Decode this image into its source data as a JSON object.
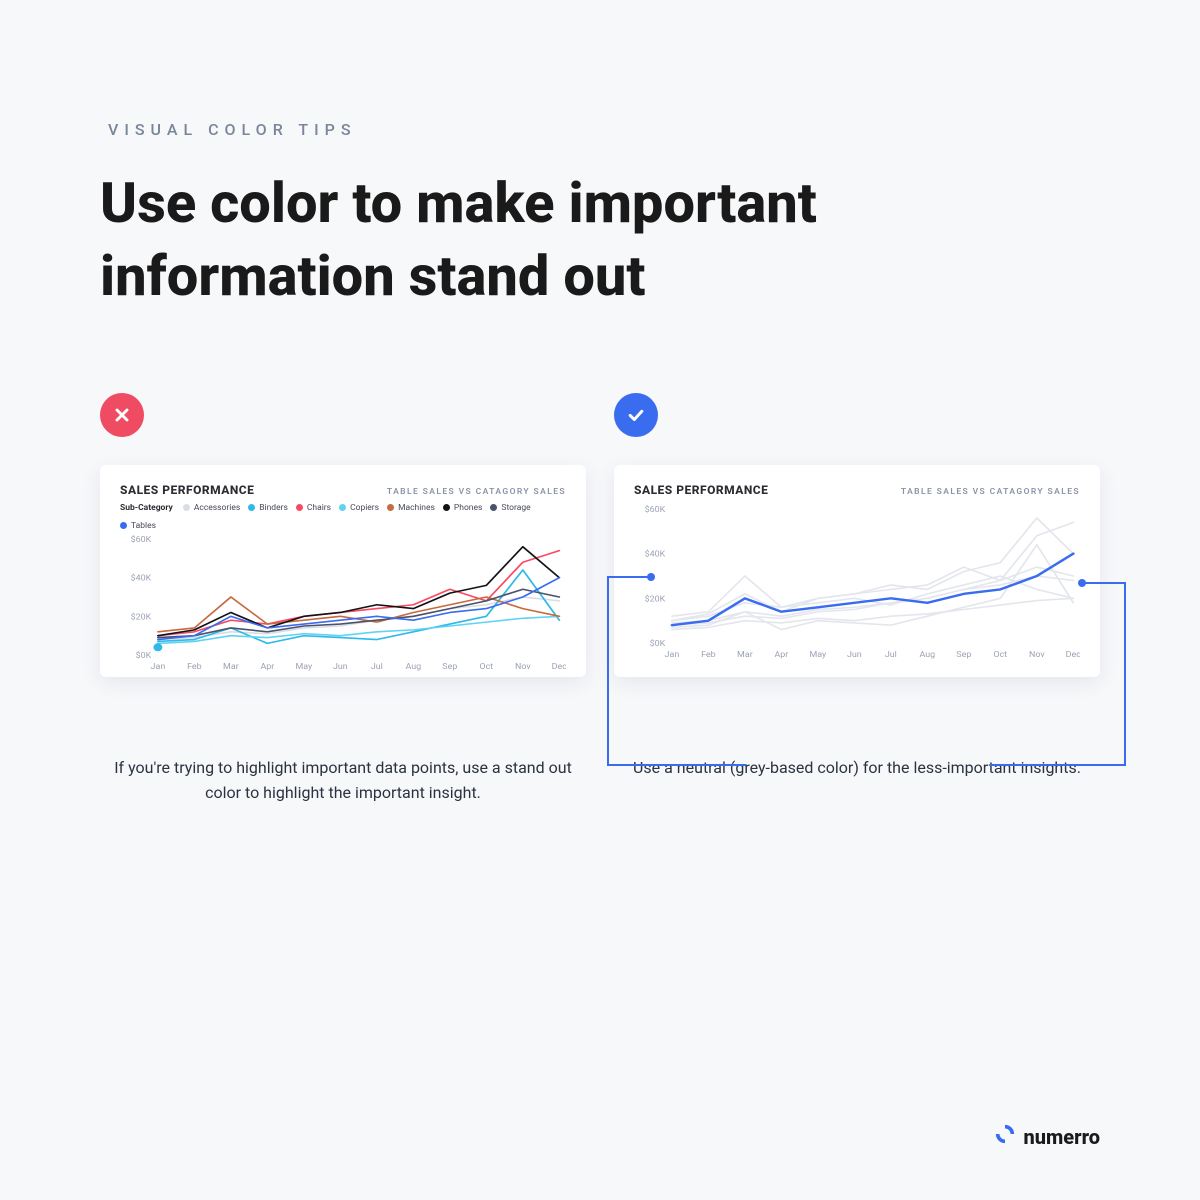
{
  "eyebrow": "VISUAL COLOR TIPS",
  "headline": "Use color to make important information stand out",
  "left": {
    "card_title": "SALES PERFORMANCE",
    "card_subtitle": "TABLE SALES VS CATAGORY SALES",
    "legend_title": "Sub-Category",
    "caption": "If you're trying to highlight important data points, use a stand out color to highlight the important insight."
  },
  "right": {
    "card_title": "SALES PERFORMANCE",
    "card_subtitle": "TABLE SALES VS CATAGORY SALES",
    "caption": "Use a neutral (grey-based color) for the less-important insights."
  },
  "brand": "numerro",
  "chart_data": [
    {
      "type": "line",
      "title": "SALES PERFORMANCE",
      "subtitle": "TABLE SALES VS CATAGORY SALES",
      "xlabel": "",
      "ylabel": "",
      "ylim": [
        0,
        60
      ],
      "y_ticks": [
        "$0K",
        "$20K",
        "$40K",
        "$60K"
      ],
      "categories": [
        "Jan",
        "Feb",
        "Mar",
        "Apr",
        "May",
        "Jun",
        "Jul",
        "Aug",
        "Sep",
        "Oct",
        "Nov",
        "Dec"
      ],
      "series": [
        {
          "name": "Accessories",
          "color": "#d8dde5",
          "values": [
            8,
            9,
            12,
            11,
            14,
            15,
            18,
            20,
            24,
            26,
            30,
            28
          ]
        },
        {
          "name": "Binders",
          "color": "#2fb8ea",
          "values": [
            7,
            8,
            14,
            6,
            10,
            9,
            8,
            12,
            16,
            20,
            44,
            18
          ]
        },
        {
          "name": "Chairs",
          "color": "#fa4a63",
          "values": [
            10,
            12,
            18,
            16,
            20,
            22,
            24,
            26,
            34,
            28,
            48,
            54
          ]
        },
        {
          "name": "Copiers",
          "color": "#5fd3f2",
          "values": [
            6,
            7,
            10,
            9,
            11,
            10,
            12,
            13,
            15,
            17,
            19,
            20
          ]
        },
        {
          "name": "Machines",
          "color": "#c76a3e",
          "values": [
            12,
            14,
            30,
            16,
            18,
            20,
            17,
            22,
            26,
            30,
            24,
            20
          ]
        },
        {
          "name": "Phones",
          "color": "#121217",
          "values": [
            10,
            13,
            22,
            14,
            20,
            22,
            26,
            24,
            32,
            36,
            56,
            40
          ]
        },
        {
          "name": "Storage",
          "color": "#4a536b",
          "values": [
            9,
            10,
            14,
            12,
            15,
            16,
            18,
            20,
            24,
            28,
            34,
            30
          ]
        },
        {
          "name": "Tables",
          "color": "#3a6cf0",
          "values": [
            8,
            10,
            20,
            14,
            16,
            18,
            20,
            18,
            22,
            24,
            30,
            40
          ]
        }
      ]
    },
    {
      "type": "line",
      "title": "SALES PERFORMANCE",
      "subtitle": "TABLE SALES VS CATAGORY SALES",
      "xlabel": "",
      "ylabel": "",
      "ylim": [
        0,
        60
      ],
      "y_ticks": [
        "$0K",
        "$20K",
        "$40K",
        "$60K"
      ],
      "categories": [
        "Jan",
        "Feb",
        "Mar",
        "Apr",
        "May",
        "Jun",
        "Jul",
        "Aug",
        "Sep",
        "Oct",
        "Nov",
        "Dec"
      ],
      "highlight_series": "Tables",
      "muted_color": "#e3e6ec",
      "highlight_color": "#3a6cf0",
      "series": [
        {
          "name": "Accessories",
          "values": [
            8,
            9,
            12,
            11,
            14,
            15,
            18,
            20,
            24,
            26,
            30,
            28
          ]
        },
        {
          "name": "Binders",
          "values": [
            7,
            8,
            14,
            6,
            10,
            9,
            8,
            12,
            16,
            20,
            44,
            18
          ]
        },
        {
          "name": "Chairs",
          "values": [
            10,
            12,
            18,
            16,
            20,
            22,
            24,
            26,
            34,
            28,
            48,
            54
          ]
        },
        {
          "name": "Copiers",
          "values": [
            6,
            7,
            10,
            9,
            11,
            10,
            12,
            13,
            15,
            17,
            19,
            20
          ]
        },
        {
          "name": "Machines",
          "values": [
            12,
            14,
            30,
            16,
            18,
            20,
            17,
            22,
            26,
            30,
            24,
            20
          ]
        },
        {
          "name": "Phones",
          "values": [
            10,
            13,
            22,
            14,
            20,
            22,
            26,
            24,
            32,
            36,
            56,
            40
          ]
        },
        {
          "name": "Storage",
          "values": [
            9,
            10,
            14,
            12,
            15,
            16,
            18,
            20,
            24,
            28,
            34,
            30
          ]
        },
        {
          "name": "Tables",
          "values": [
            8,
            10,
            20,
            14,
            16,
            18,
            20,
            18,
            22,
            24,
            30,
            40
          ]
        }
      ]
    }
  ]
}
